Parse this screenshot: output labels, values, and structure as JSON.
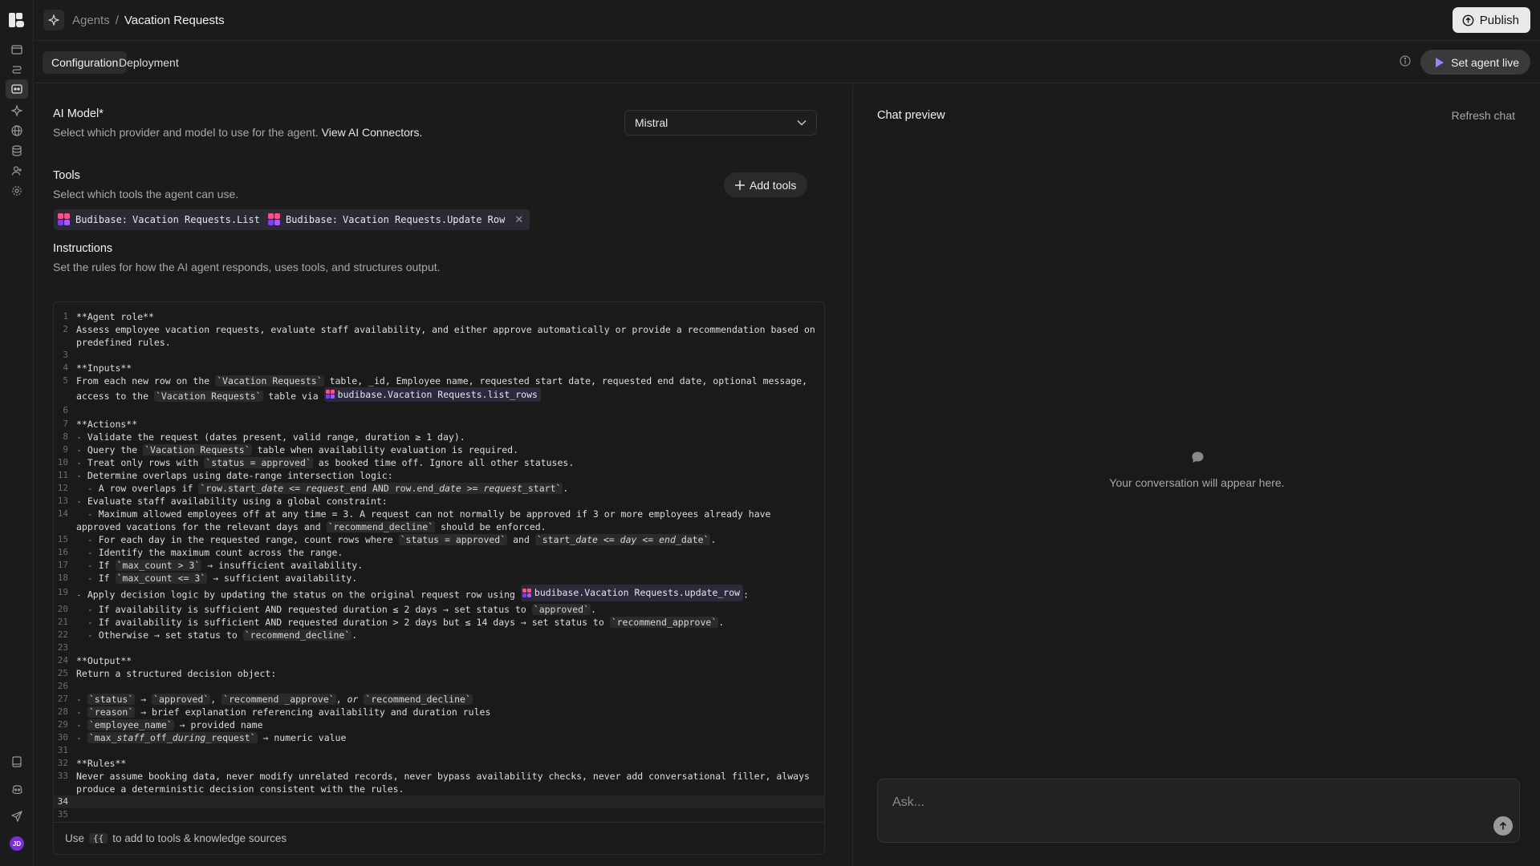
{
  "header": {
    "breadcrumb_parent": "Agents",
    "breadcrumb_sep": "/",
    "breadcrumb_current": "Vacation Requests",
    "publish_label": "Publish"
  },
  "tabs": [
    {
      "label": "Configuration",
      "active": true
    },
    {
      "label": "Deployment",
      "active": false
    }
  ],
  "set_live_label": "Set agent live",
  "model": {
    "title": "AI Model*",
    "desc": "Select which provider and model to use for the agent.",
    "link": "View AI Connectors.",
    "selected": "Mistral"
  },
  "tools": {
    "title": "Tools",
    "desc": "Select which tools the agent can use.",
    "add_label": "Add tools",
    "chips": [
      {
        "prefix": "Budibase:",
        "label": "Vacation Requests.List Rows"
      },
      {
        "prefix": "Budibase:",
        "label": "Vacation Requests.Update Row"
      }
    ]
  },
  "instructions": {
    "title": "Instructions",
    "desc": "Set the rules for how the AI agent responds, uses tools, and structures output.",
    "footer_pre": "Use",
    "footer_key": "{{",
    "footer_post": "to add to tools & knowledge sources",
    "tool_list_rows": "budibase.Vacation Requests.list_rows",
    "tool_update_row": "budibase.Vacation Requests.update_row",
    "line_count": 35
  },
  "chat": {
    "title": "Chat preview",
    "refresh_label": "Refresh chat",
    "empty_text": "Your conversation will appear here.",
    "placeholder": "Ask..."
  },
  "user": {
    "initials": "JD"
  },
  "colors": {
    "accent_purple": "#b46bff",
    "budibase_pink": "#ff4f8b",
    "budibase_purple": "#7b3ff2",
    "avatar": "#7a2fd6"
  }
}
